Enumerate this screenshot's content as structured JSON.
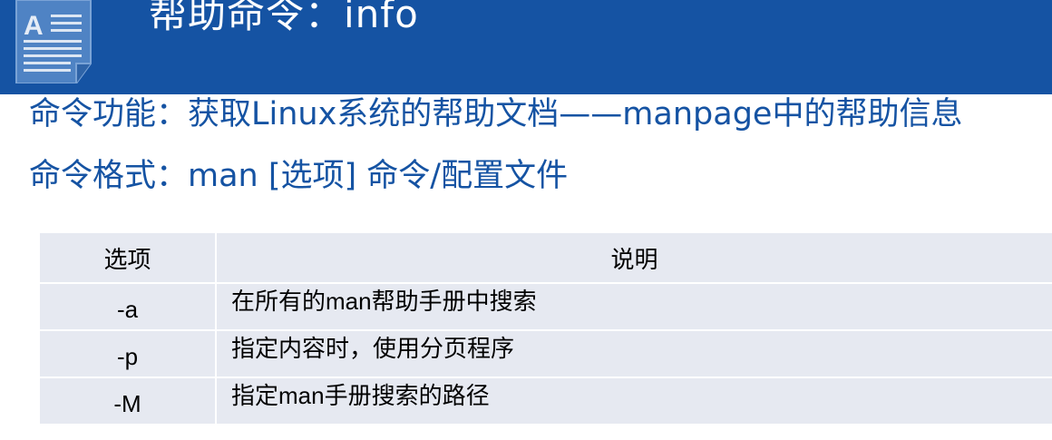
{
  "slide": {
    "title": "帮助命令：info",
    "icon": "document-text-icon",
    "colors": {
      "header_bg": "#1553a3",
      "title_text": "#ffffff",
      "body_text": "#1553a3",
      "table_bg": "#e6e9f1"
    }
  },
  "description": {
    "function_line": "命令功能：获取Linux系统的帮助文档——manpage中的帮助信息",
    "format_line": "命令格式：man [选项] 命令/配置文件"
  },
  "options_table": {
    "headers": [
      "选项",
      "说明"
    ],
    "rows": [
      {
        "option": "-a",
        "description": "在所有的man帮助手册中搜索"
      },
      {
        "option": "-p",
        "description": "指定内容时，使用分页程序"
      },
      {
        "option": "-M",
        "description": "指定man手册搜索的路径"
      }
    ]
  }
}
